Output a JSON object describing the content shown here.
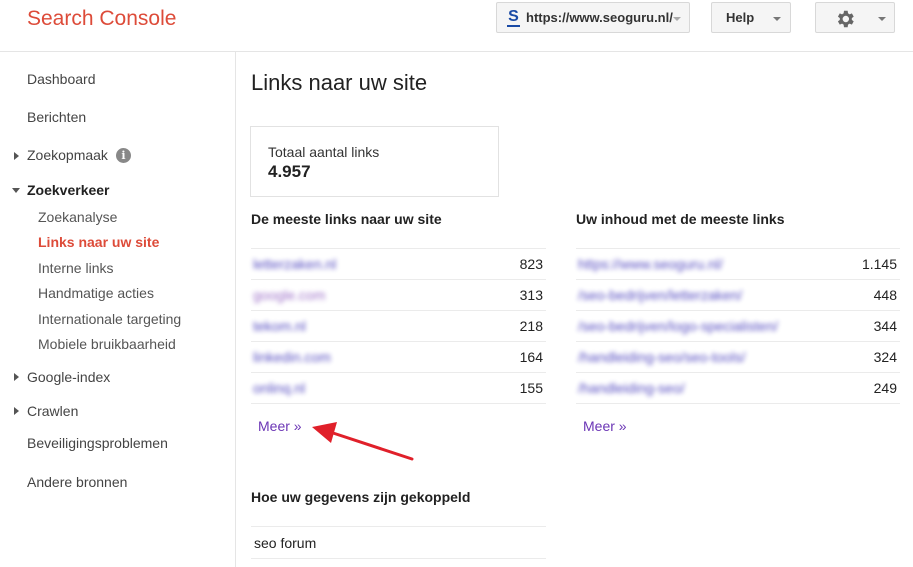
{
  "header": {
    "app_title": "Search Console",
    "site_url": "https://www.seoguru.nl/",
    "site_icon": "S",
    "help_label": "Help",
    "settings_icon": "gear-icon"
  },
  "sidebar": {
    "dashboard": "Dashboard",
    "berichten": "Berichten",
    "zoekopmaak": "Zoekopmaak",
    "info_glyph": "i",
    "zoekverkeer": "Zoekverkeer",
    "zoekanalyse": "Zoekanalyse",
    "links_naar_uw_site": "Links naar uw site",
    "interne_links": "Interne links",
    "handmatige_acties": "Handmatige acties",
    "internationale_targeting": "Internationale targeting",
    "mobiele_bruikbaarheid": "Mobiele bruikbaarheid",
    "google_index": "Google-index",
    "crawlen": "Crawlen",
    "beveiligingsproblemen": "Beveiligingsproblemen",
    "andere_bronnen": "Andere bronnen"
  },
  "main": {
    "title": "Links naar uw site",
    "total_label": "Totaal aantal links",
    "total_value": "4.957",
    "most_links_title": "De meeste links naar uw site",
    "most_links": [
      {
        "domain": "letterzaken.nl",
        "count": "823"
      },
      {
        "domain": "google.com",
        "count": "313"
      },
      {
        "domain": "tekom.nl",
        "count": "218"
      },
      {
        "domain": "linkedin.com",
        "count": "164"
      },
      {
        "domain": "onlinq.nl",
        "count": "155"
      }
    ],
    "content_title": "Uw inhoud met de meeste links",
    "content_links": [
      {
        "page": "https://www.seoguru.nl/",
        "count": "1.145"
      },
      {
        "page": "/seo-bedrijven/letterzaken/",
        "count": "448"
      },
      {
        "page": "/seo-bedrijven/logo-specialisten/",
        "count": "344"
      },
      {
        "page": "/handleiding-seo/seo-tools/",
        "count": "324"
      },
      {
        "page": "/handleiding-seo/",
        "count": "249"
      }
    ],
    "meer_label": "Meer »",
    "anchor_title": "Hoe uw gegevens zijn gekoppeld",
    "anchor_rows": [
      "seo forum"
    ]
  },
  "colors": {
    "brand": "#dd4b39",
    "link": "#1a0dab",
    "visited": "#6b35b5",
    "annotation_arrow": "#e0202a"
  }
}
